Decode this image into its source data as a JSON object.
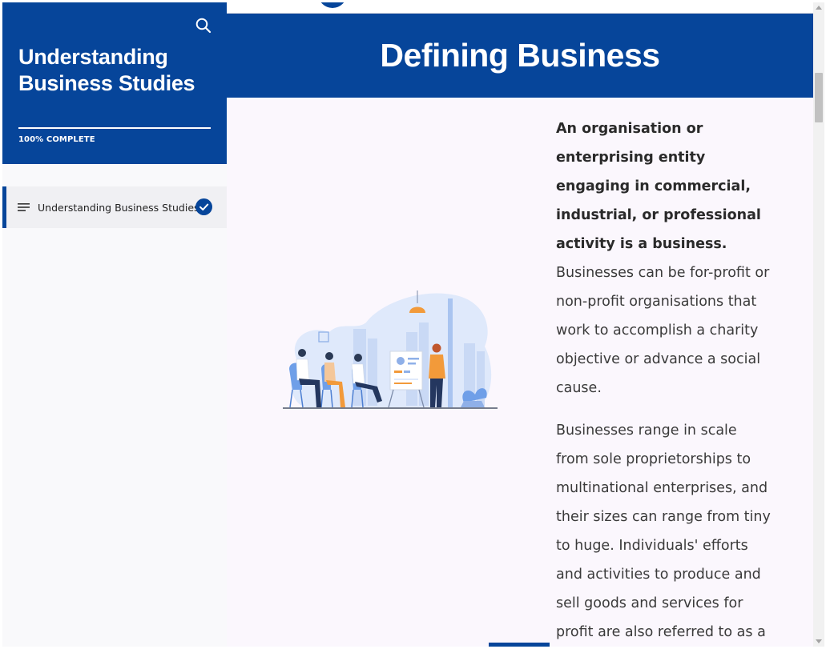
{
  "sidebar": {
    "course_title": "Understanding Business Studies",
    "progress_label": "100% COMPLETE",
    "progress_percent": 100,
    "lessons": [
      {
        "label": "Understanding Business Studies",
        "status": "complete"
      }
    ]
  },
  "lesson": {
    "title": "Defining Business",
    "paragraph_1_bold": "An organisation or enterprising entity engaging in commercial, industrial, or professional activity is a business.",
    "paragraph_1_rest": " Businesses can be for-profit or non-profit organisations that work to accomplish a charity objective or advance a social cause.",
    "paragraph_2": "Businesses range in scale from sole proprietorships to multinational enterprises, and their sizes can range from tiny to huge. Individuals' efforts and activities to produce and sell goods and services for profit are also referred to as a business."
  },
  "icons": {
    "search": "search-icon",
    "menu": "menu-lines-icon",
    "check": "check-circle-icon"
  },
  "colors": {
    "brand": "#06459a",
    "main_bg": "#fbf7fd",
    "sidebar_bg": "#f9f9fb",
    "accent_orange": "#f29a3a"
  }
}
